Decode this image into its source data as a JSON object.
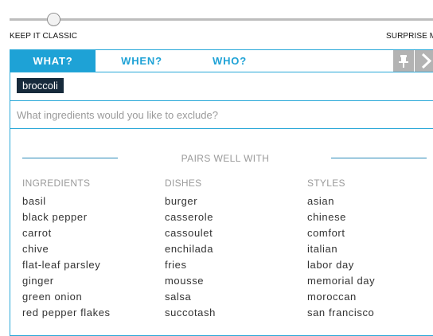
{
  "slider": {
    "left_label": "KEEP IT CLASSIC",
    "right_label": "SURPRISE ME"
  },
  "tabs": [
    {
      "label": "WHAT?",
      "active": true
    },
    {
      "label": "WHEN?",
      "active": false
    },
    {
      "label": "WHO?",
      "active": false
    }
  ],
  "toolbar": {
    "pin_icon": "pin-icon",
    "next_icon": "chevron-right-icon"
  },
  "include": {
    "chips": [
      "broccoli"
    ]
  },
  "exclude": {
    "placeholder": "What ingredients would you like to exclude?",
    "value": ""
  },
  "pairs": {
    "title": "PAIRS WELL WITH",
    "columns": [
      {
        "heading": "INGREDIENTS",
        "items": [
          "basil",
          "black pepper",
          "carrot",
          "chive",
          "flat-leaf parsley",
          "ginger",
          "green onion",
          "red pepper flakes"
        ]
      },
      {
        "heading": "DISHES",
        "items": [
          "burger",
          "casserole",
          "cassoulet",
          "enchilada",
          "fries",
          "mousse",
          "salsa",
          "succotash"
        ]
      },
      {
        "heading": "STYLES",
        "items": [
          "asian",
          "chinese",
          "comfort",
          "italian",
          "labor day",
          "memorial day",
          "moroccan",
          "san francisco"
        ]
      }
    ]
  },
  "colors": {
    "accent": "#1ea2d6",
    "chip_bg": "#162a3b",
    "muted_text": "#9a9a9a",
    "button_gray": "#b3b3b3"
  }
}
